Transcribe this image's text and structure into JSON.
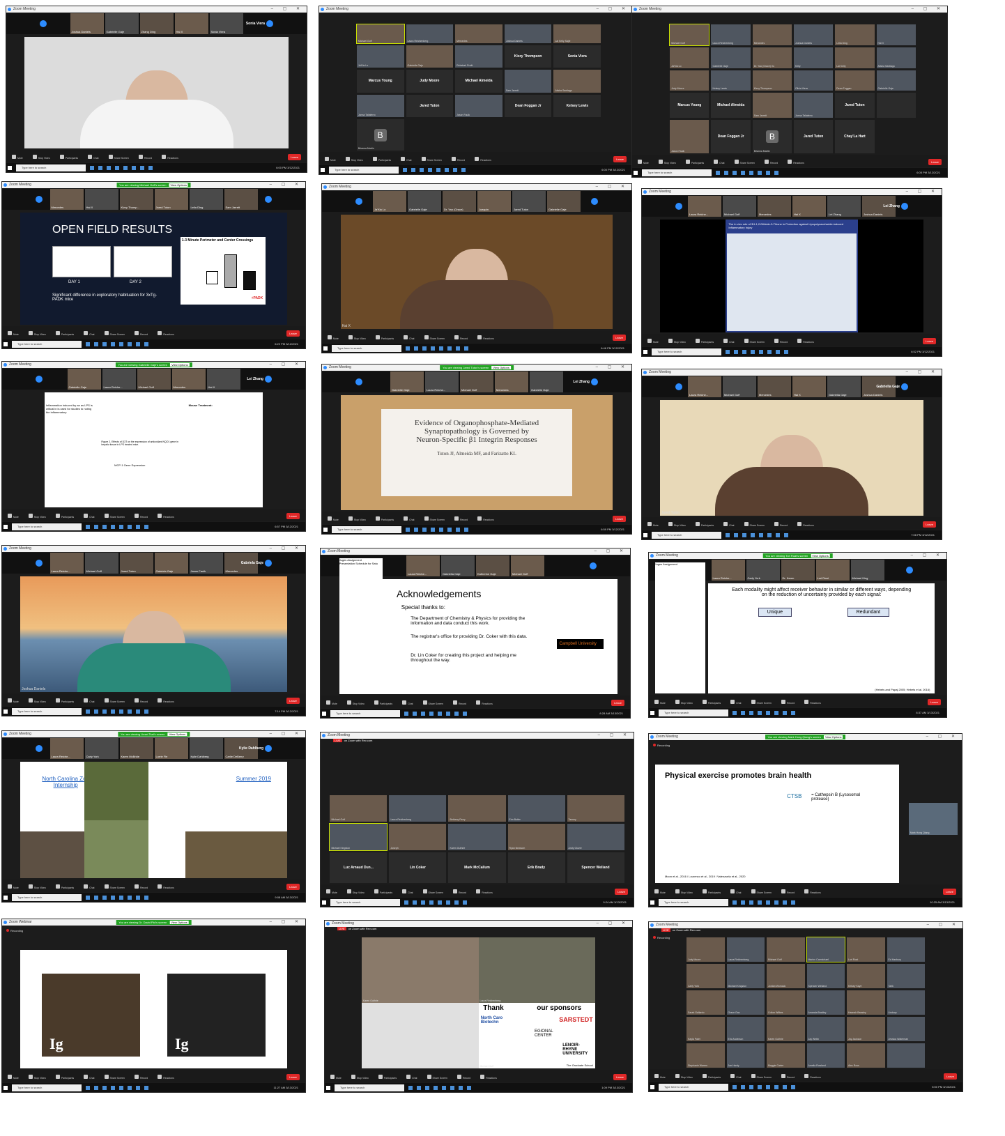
{
  "windows": [
    {
      "id": "w1",
      "title": "Zoom Meeting",
      "kind": "speaker",
      "speaker": "Sonia Viera",
      "strip": [
        "Joshua Daniels",
        "Gabrielle Gaje",
        "Zhang Ding",
        "Hai X",
        "Sonia Viera"
      ],
      "main_label": "",
      "bottom_name": "Michael Goff",
      "clock": "6:00 PM 3/12/2021",
      "search": "Type here to search"
    },
    {
      "id": "w2",
      "title": "Zoom Meeting",
      "kind": "gallery",
      "cols": 5,
      "tiles": [
        {
          "t": "Michael Goff",
          "v": true,
          "sel": true
        },
        {
          "t": "Laura Reichenberg",
          "v": true
        },
        {
          "t": "Mercedes",
          "v": true
        },
        {
          "t": "Joshua Daniels",
          "v": true
        },
        {
          "t": "Lai Kelly Sajie",
          "v": true
        },
        {
          "t": "Ja'Kia Lo",
          "v": true
        },
        {
          "t": "Gabrielle Gaje",
          "v": true
        },
        {
          "t": "Rebekah Pruitt",
          "v": true
        },
        {
          "n": "Kizzy Thompson"
        },
        {
          "n": "Sonia Viera"
        },
        {
          "n": "Marcus Young"
        },
        {
          "n": "Judy Moore"
        },
        {
          "n": "Michael Almeida"
        },
        {
          "t": "Sam Jarrett",
          "v": true
        },
        {
          "t": "Alisha Santiago",
          "v": true
        },
        {
          "t": "Janna Taliaferro",
          "v": true
        },
        {
          "n": "Jared Tuton"
        },
        {
          "t": "Jason Faulk",
          "v": true
        },
        {
          "n": "Dean Foggan Jr"
        },
        {
          "n": "Kelsey Lewis"
        },
        {
          "n": "",
          "B": "B",
          "t": "Brianna Martin"
        }
      ],
      "clock": "6:00 PM 3/12/2021",
      "search": "Type here to search"
    },
    {
      "id": "w3",
      "title": "Zoom Meeting",
      "kind": "gallery",
      "cols": 6,
      "tiles": [
        {
          "t": "Michael Goff",
          "v": true,
          "sel": true
        },
        {
          "t": "Laura Reichenberg",
          "v": true
        },
        {
          "t": "Mercedes",
          "v": true
        },
        {
          "t": "Joshua Daniels",
          "v": true
        },
        {
          "t": "Lelia Ding",
          "v": true
        },
        {
          "t": "Hai X",
          "v": true
        },
        {
          "t": "Ja'Kia Lo",
          "v": true
        },
        {
          "t": "Gabrielle Gaje",
          "v": true
        },
        {
          "t": "Dr. Yao (Grace) Xu",
          "v": true
        },
        {
          "t": "Kelly",
          "v": true
        },
        {
          "t": "Lai Kelly",
          "v": true
        },
        {
          "t": "Alisha Santiago",
          "v": true
        },
        {
          "t": "Judy Moore",
          "v": true
        },
        {
          "t": "Kelsey Lewis",
          "v": true
        },
        {
          "t": "Kizzy Thompson",
          "v": true
        },
        {
          "t": "Olivia Viera",
          "v": true
        },
        {
          "t": "Dean Foggan",
          "v": true
        },
        {
          "t": "Gabrielle Gaje",
          "v": true
        },
        {
          "n": "Marcus Young"
        },
        {
          "n": "Michael Almeida"
        },
        {
          "t": "Sam Jarrett",
          "v": true
        },
        {
          "t": "Janna Taliaferro",
          "v": true
        },
        {
          "n": "Jared Tuton"
        },
        {
          "n": ""
        },
        {
          "t": "Jason Faulk",
          "v": true
        },
        {
          "n": "Dean Foggan Jr"
        },
        {
          "n": "",
          "B": "B",
          "t": "Brianna Martin"
        },
        {
          "n": "Jared Tuton"
        },
        {
          "n": "Chay'La Hart"
        }
      ],
      "clock": "6:05 PM 3/12/2021",
      "search": "Type here to search"
    },
    {
      "id": "w4",
      "title": "Zoom Meeting",
      "kind": "slide",
      "banner": "You are viewing Michael Goff's screen",
      "banner_btn": "View Options",
      "strip": [
        "Mercedes",
        "Hai X",
        "Kizzy Thomp...",
        "Jared Tuton",
        "Lelia Ding",
        "Sam Jarrett"
      ],
      "slide_title": "OPEN FIELD RESULTS",
      "day1": "DAY 1",
      "day2": "DAY 2",
      "chart_title": "1-3 Minute Perimeter and Center Crossings",
      "ylabel": "Percent Change of Day 1 vs. Day2",
      "caption": "Significant difference in exploratory habituation for 3xTg-PADK mice",
      "xcats": [
        "WT Mice",
        "3xTg-AD",
        "3xTg-AD"
      ],
      "padk": "+PADK",
      "clock": "6:22 PM 3/12/2021",
      "search": "Type here to search"
    },
    {
      "id": "w5",
      "title": "Zoom Meeting",
      "kind": "speaker",
      "strip": [
        "Ja'Kia Lo",
        "Gabrielle Gaje",
        "Dr. Yao (Grace)",
        "Joaquin",
        "Jared Tuton",
        "Gabrielle Gaje"
      ],
      "bottom_name": "Hai X",
      "clock": "6:46 PM 3/12/2021",
      "search": "Type here to search"
    },
    {
      "id": "w6",
      "title": "Zoom Meeting",
      "kind": "poster",
      "speaker": "Lei Zhang",
      "strip": [
        "Laura Reiche...",
        "Michael Goff",
        "Mercedes",
        "Hai X",
        "Lei Zhang",
        "Joshua Daniels"
      ],
      "poster_title": "The in vivo role of 3H-1,2-Dithiole-3-Thione in Protection against Lipopolysaccharide-induced Inflammatory Injury",
      "uni": "CAMPBELL UNIVERSITY",
      "clock": "6:52 PM 3/12/2021",
      "search": "Type here to search"
    },
    {
      "id": "w7",
      "title": "Zoom Meeting",
      "kind": "doc",
      "banner": "You are viewing Gabrielle Gaje's screen",
      "banner_btn": "View Options",
      "speaker": "Lei Zhang",
      "strip": [
        "Gabrielle Gaje",
        "Laura Reiche...",
        "Michael Goff",
        "Mercedes",
        "Hai X"
      ],
      "doc_head_left": "Inflammation induced by an as LPS is critical in is used for studies to noting the inflammatory",
      "doc_head_right": "Mouse Treatment:",
      "fig_caption": "Figure 2. Effects of D3T on the expression of antioxidant NQO1 gene in hepatic tissue in LPS treated mice.",
      "fig2": "MCP-1 Gene Expression",
      "side": [
        "Create PDF",
        "Combine Files",
        "Edit PDF",
        "Export PDF",
        "Fill & Sign",
        "Organize Pages",
        "Send for Comments",
        "Comment",
        "Scan & OCR",
        "Protect",
        "More Tools"
      ],
      "clock": "6:57 PM 3/12/2021",
      "search": "Type here to search"
    },
    {
      "id": "w8",
      "title": "Zoom Meeting",
      "kind": "titleslide",
      "banner": "You are viewing Jared Tuton's screen",
      "banner_btn": "View Options",
      "speaker": "Lei Zhang",
      "strip": [
        "Gabrielle Gaje",
        "Laura Reiche...",
        "Michael Goff",
        "Mercedes",
        "Gabrielle Gaje"
      ],
      "t1": "Evidence of Organophosphate-Mediated",
      "t2": "Synaptopathology is Governed by",
      "t3": "Neuron-Specific β1 Integrin Responses",
      "authors": "Tuton JJ, Almeida MF, and Farizatto KL",
      "clock": "6:59 PM 3/12/2021",
      "search": "Type here to search"
    },
    {
      "id": "w9",
      "title": "Zoom Meeting",
      "kind": "speaker",
      "speaker": "Gabriella Gaje",
      "strip": [
        "Laura Reiche...",
        "Michael Goff",
        "Mercedes",
        "Hai X",
        "Gabriella Gaje",
        "Joshua Daniels"
      ],
      "bottom_name": "Jared Tuton",
      "clock": "7:08 PM 3/12/2021",
      "search": "Type here to search"
    },
    {
      "id": "w10",
      "title": "Zoom Meeting",
      "kind": "speaker",
      "speaker": "Gabriela Gaje",
      "strip": [
        "Laura Reiche...",
        "Michael Goff",
        "Jared Tuton",
        "Gabriela Gaje",
        "Jason Faulk",
        "Mercedes"
      ],
      "bottom_name": "Joshua Daniels",
      "clock": "7:14 PM 3/12/2021",
      "search": "Type here to search"
    },
    {
      "id": "w11",
      "title": "Zoom Meeting",
      "kind": "ack",
      "strip": [
        "Laura Reiche...",
        "Gabriella Gaje",
        "Katherine Gaje",
        "Michael Goff"
      ],
      "doc_title": "Juges Assignment",
      "sched": "Presentation Schedule for Satu",
      "ack_title": "Acknowledgements",
      "ack_intro": "Special thanks to:",
      "ack_items": [
        "The Department of Chemistry & Physics for providing the information and data conduct this work.",
        "The registrar's office for providing Dr. Coker with this data.",
        "Dr. Lin Coker for creating this project and helping me throughout the way."
      ],
      "logo": "Campbell University",
      "dept": "Department of Chemistry and Physics",
      "clock": "8:28 AM 3/13/2021",
      "search": "Type here to search"
    },
    {
      "id": "w12",
      "title": "Zoom Meeting",
      "kind": "modality",
      "banner": "You are viewing Tori Roat's screen",
      "banner_btn": "View Options",
      "strip": [
        "Laura Reiche...",
        "Carly York",
        "Dr. Karen",
        "Lori Roat",
        "Michael King"
      ],
      "doc_title": "Juges Assignment",
      "q": "Each modality might affect receiver behavior in similar or different ways, depending on the reduction of uncertainty provided by each signal:",
      "b1": "Unique",
      "b2": "Redundant",
      "ref": "(Hebets and Papaj 2005; Hebets et al. 2016)",
      "clock": "8:37 AM 3/13/2021",
      "search": "Type here to search"
    },
    {
      "id": "w13",
      "title": "Zoom Meeting",
      "kind": "zoo",
      "banner": "You are viewing Liesel Tsai's screen",
      "banner_btn": "View Options",
      "speaker": "Kylie Dahlberg",
      "recording": "Recording",
      "strip": [
        "Laura Reiche...",
        "Carly York",
        "Karen McBride",
        "Lorrie Fie",
        "Kylie Dahlberg",
        "Carlie DeBerry"
      ],
      "left": "North Carolina Zoo Internship",
      "right": "Summer 2019",
      "clock": "9:08 AM 3/13/2021",
      "search": "Type here to search"
    },
    {
      "id": "w14",
      "title": "Zoom Meeting",
      "kind": "gallery",
      "cols": 5,
      "live": "LIVE",
      "live_on": "on Zoom with Rev.com",
      "tiles": [
        {
          "t": "Michael Goff",
          "v": true
        },
        {
          "t": "Laura Reichenberg",
          "v": true
        },
        {
          "t": "Bethany Perry",
          "v": true
        },
        {
          "t": "Erin Butler",
          "v": true
        },
        {
          "t": "Tammy",
          "v": true
        },
        {
          "t": "Michael Kingston",
          "v": true,
          "sel": true
        },
        {
          "t": "Joseph",
          "v": true
        },
        {
          "t": "Karen Guthrie",
          "v": true
        },
        {
          "t": "Ryan Newsom",
          "v": true
        },
        {
          "t": "Andy Glover",
          "v": true
        },
        {
          "n": "Luc Arnaud Dun..."
        },
        {
          "n": "Lin Coker"
        },
        {
          "n": "Mark McCallum"
        },
        {
          "n": "Erik Brady"
        },
        {
          "n": "Spencer Welland"
        }
      ],
      "clock": "9:24 AM 3/13/2021",
      "search": "Type here to search"
    },
    {
      "id": "w15",
      "title": "Zoom Meeting",
      "kind": "exercise",
      "banner": "You are viewing Mark Hong Qiang's screen",
      "banner_btn": "View Options",
      "recording": "Recording",
      "slide_title": "Physical exercise promotes brain health",
      "ctsb": "CTSB",
      "cath": "= Cathepsin B (Lysosomal protease)",
      "cite": "Moon et al., 2016 / Lourenco et al., 2019 / Valenzuela et al., 2020",
      "speaker_tag": "Mark Hong Qiang",
      "clock": "10:25 AM 3/13/2021",
      "search": "Type here to search"
    },
    {
      "id": "w16",
      "title": "Zoom Webinar",
      "kind": "photos",
      "banner": "You are viewing Dr. David Pici's screen",
      "banner_btn": "View Options",
      "recording": "Recording",
      "glyph": "Ig",
      "bottom": "Audio Settings",
      "clock": "11:27 AM 3/13/2021",
      "search": "Type here to search"
    },
    {
      "id": "w17",
      "title": "Zoom Meeting",
      "kind": "sponsors",
      "live": "LIVE",
      "live_on": "on Zoom with Rev.com",
      "names": [
        "Karen Guthrie",
        "Laura Reichenberg",
        "Aisha",
        "Michael Goff"
      ],
      "thanks": "Thank",
      "sponsors": "our sponsors",
      "s1": "SARSTEDT",
      "s2": "North Caro Biotechn",
      "s3": "EGIONAL CENTER",
      "s4": "LENOIR-RHYNE UNIVERSITY",
      "s5": "The Graduate School",
      "clock": "1:09 PM 3/13/2021",
      "search": "Type here to search"
    },
    {
      "id": "w18",
      "title": "Zoom Meeting",
      "kind": "gallery",
      "cols": 6,
      "live": "LIVE",
      "live_on": "on Zoom with Rev.com",
      "recording": "Recording",
      "tiles": [
        {
          "t": "Judy Moore",
          "v": true
        },
        {
          "t": "Laura Reichenberg",
          "v": true
        },
        {
          "t": "Michael Goff",
          "v": true
        },
        {
          "t": "Marion Carmichael",
          "v": true,
          "sel": true
        },
        {
          "t": "Lori Roat",
          "v": true
        },
        {
          "t": "Ed Hanbury",
          "v": true
        },
        {
          "t": "Carly York",
          "v": true
        },
        {
          "t": "Michael Kingston",
          "v": true
        },
        {
          "t": "Jordan Womack",
          "v": true
        },
        {
          "t": "Spencer Welland",
          "v": true
        },
        {
          "t": "Kelsey Kaye",
          "v": true
        },
        {
          "t": "Tarik",
          "v": true
        },
        {
          "t": "Sarah Gallardo",
          "v": true
        },
        {
          "t": "Grace Gao",
          "v": true
        },
        {
          "t": "Colton Wilkes",
          "v": true
        },
        {
          "t": "Amanda Bradley",
          "v": true
        },
        {
          "t": "Hannah Beasley",
          "v": true
        },
        {
          "t": "Lindsay",
          "v": true
        },
        {
          "t": "Kayla Patel",
          "v": true
        },
        {
          "t": "Eric Anderson",
          "v": true
        },
        {
          "t": "Karen Guthrie",
          "v": true
        },
        {
          "t": "Jay Webb",
          "v": true
        },
        {
          "t": "Jay Jackson",
          "v": true
        },
        {
          "t": "Jessica Waterman",
          "v": true
        },
        {
          "t": "Stephanie Warren",
          "v": true
        },
        {
          "t": "Jan Hardy",
          "v": true
        },
        {
          "t": "Maggie Carter",
          "v": true
        },
        {
          "t": "Amelia Rowland",
          "v": true
        },
        {
          "t": "Alec Ross",
          "v": true
        },
        {
          "t": "",
          "v": true
        }
      ],
      "clock": "5:50 PM 3/13/2021",
      "search": "Type here to search"
    }
  ],
  "controls": [
    "Mute",
    "Stop Video",
    "Participants",
    "Chat",
    "Share Screen",
    "Record",
    "Reactions"
  ],
  "leave": "Leave",
  "colors": {
    "zoom_blue": "#2d8cff",
    "leave_red": "#e02828",
    "share_green": "#23a323"
  }
}
